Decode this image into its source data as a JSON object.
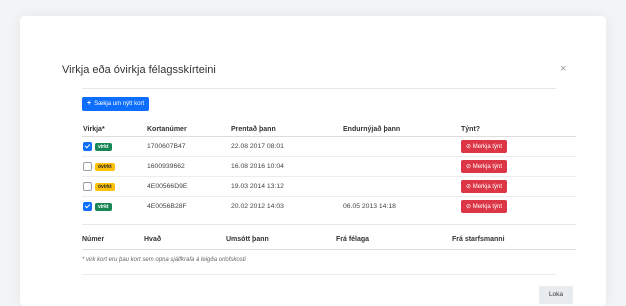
{
  "modal": {
    "title": "Virkja eða óvirkja félagsskírteini",
    "close_glyph": "×",
    "new_card_button": "Sækja um nýtt kort",
    "table1": {
      "headers": [
        "Virkja*",
        "Kortanúmer",
        "Prentað þann",
        "Endurnýjað þann",
        "Týnt?"
      ],
      "rows": [
        {
          "checked": true,
          "status": "virkt",
          "card": "1700607B47",
          "printed": "22.08 2017 08:01",
          "renewed": "",
          "lost_button": "⊘ Merkja týnt"
        },
        {
          "checked": false,
          "status": "óvirkt",
          "card": "1600939662",
          "printed": "16.08 2016 10:04",
          "renewed": "",
          "lost_button": "⊘ Merkja týnt"
        },
        {
          "checked": false,
          "status": "óvirkt",
          "card": "4E00566D9E",
          "printed": "19.03 2014 13:12",
          "renewed": "",
          "lost_button": "⊘ Merkja týnt"
        },
        {
          "checked": true,
          "status": "virkt",
          "card": "4E0056B28F",
          "printed": "20.02 2012 14:03",
          "renewed": "06.05 2013 14:18",
          "lost_button": "⊘ Merkja týnt"
        }
      ]
    },
    "table2": {
      "headers": [
        "Númer",
        "Hvað",
        "Umsótt þann",
        "Frá félaga",
        "Frá starfsmanni"
      ]
    },
    "footnote": "* virk kort eru þau kort sem opna sjálfkrafa á leigða orlofskosti",
    "close_button": "Loka"
  },
  "colors": {
    "primary": "#0d6efd",
    "danger": "#dc3545",
    "success": "#198754",
    "warning": "#ffc107"
  }
}
